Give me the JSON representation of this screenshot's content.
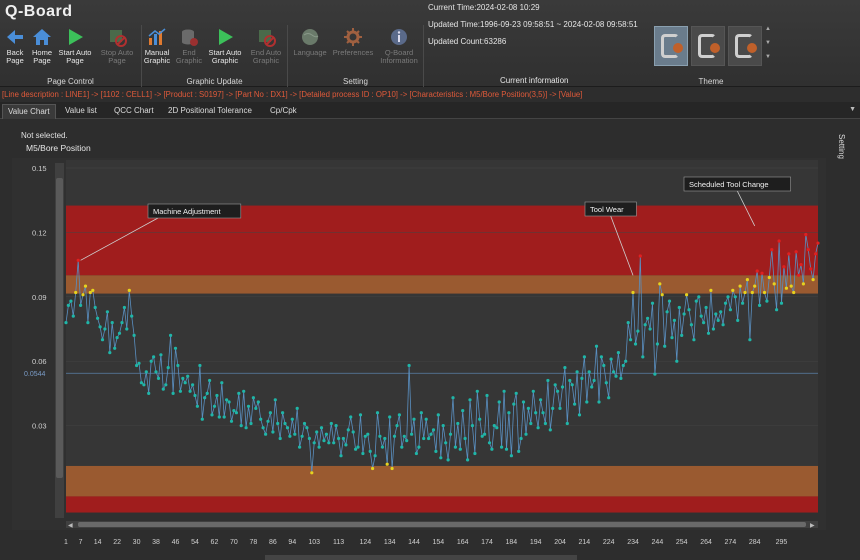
{
  "app": {
    "logo": "Q-Board"
  },
  "ribbon": {
    "page_control": {
      "label": "Page Control",
      "buttons": [
        {
          "name": "back-page-button",
          "label": "Back Page",
          "icon": "arrow-left-icon",
          "enabled": true
        },
        {
          "name": "home-page-button",
          "label": "Home Page",
          "icon": "home-icon",
          "enabled": true
        },
        {
          "name": "start-auto-page-button",
          "label": "Start Auto Page",
          "icon": "play-icon",
          "enabled": true
        },
        {
          "name": "stop-auto-page-button",
          "label": "Stop Auto Page",
          "icon": "stop-icon",
          "enabled": false
        }
      ]
    },
    "graphic_update": {
      "label": "Graphic Update",
      "buttons": [
        {
          "name": "manual-graphic-button",
          "label": "Manual Graphic",
          "icon": "bar-chart-icon",
          "enabled": true
        },
        {
          "name": "end-graphic-button",
          "label": "End Graphic",
          "icon": "database-icon",
          "enabled": false
        },
        {
          "name": "start-auto-graphic-button",
          "label": "Start Auto Graphic",
          "icon": "play-icon",
          "enabled": true
        },
        {
          "name": "end-auto-graphic-button",
          "label": "End Auto Graphic",
          "icon": "stop-icon",
          "enabled": false
        }
      ]
    },
    "setting": {
      "label": "Setting",
      "buttons": [
        {
          "name": "language-button",
          "label": "Language",
          "icon": "globe-icon",
          "enabled": false
        },
        {
          "name": "preferences-button",
          "label": "Preferences",
          "icon": "gear-icon",
          "enabled": false
        },
        {
          "name": "qboard-information-button",
          "label": "Q-Board Information",
          "icon": "info-icon",
          "enabled": false
        }
      ]
    },
    "current_information": {
      "label": "Current information",
      "current_time": "Current Time:2024-02-08 10:29",
      "updated_time": "Updated Time:1996-09-23 09:58:51 ~ 2024-02-08 09:58:51",
      "updated_count": "Updated Count:63286"
    },
    "theme": {
      "label": "Theme"
    }
  },
  "breadcrumb": "[Line description : LINE1] -> [1102 : CELL1] -> [Product : S0197] -> [Part No : DX1] -> [Detailed process ID : OP10] -> [Characteristics : M5/Bore Position(3,5)] -> [Value]",
  "tabs": [
    "Value Chart",
    "Value list",
    "QCC Chart",
    "2D Positional Tolerance",
    "Cp/Cpk"
  ],
  "active_tab": "Value Chart",
  "selection_status": "Not selected.",
  "side_panel_label": "Setting",
  "colors": {
    "limit_band": "#a01d1d",
    "warning_band": "#9a5a30",
    "point_normal": "#1fb6a8",
    "point_warning": "#e6d21e",
    "point_out": "#e02020",
    "line": "#5a8fc0",
    "center_line": "#5a7fa8"
  },
  "chart_data": {
    "type": "line",
    "title": "M5/Bore Position",
    "ylim": [
      0,
      0.15
    ],
    "yticks": [
      "0.15",
      "0.12",
      "0.09",
      "0.06",
      "0.03"
    ],
    "center_line": 0.0544,
    "center_label": "0.0544",
    "usl": 0.1,
    "lsl": 0.0,
    "xticks": [
      1,
      7,
      14,
      22,
      30,
      38,
      46,
      54,
      62,
      70,
      78,
      86,
      94,
      103,
      113,
      124,
      134,
      144,
      154,
      164,
      174,
      184,
      194,
      204,
      214,
      224,
      234,
      244,
      254,
      264,
      274,
      284,
      295
    ],
    "annotations": [
      {
        "text": "Machine Adjustment",
        "x": 7,
        "y": 0.107
      },
      {
        "text": "Tool Wear",
        "x": 234,
        "y": 0.1
      },
      {
        "text": "Scheduled Tool Change",
        "x": 284,
        "y": 0.123
      }
    ],
    "series": [
      {
        "values": [
          0.078,
          0.086,
          0.088,
          0.081,
          0.092,
          0.107,
          0.086,
          0.091,
          0.095,
          0.078,
          0.092,
          0.093,
          0.085,
          0.08,
          0.076,
          0.07,
          0.075,
          0.083,
          0.064,
          0.078,
          0.066,
          0.071,
          0.073,
          0.078,
          0.085,
          0.075,
          0.093,
          0.081,
          0.072,
          0.058,
          0.059,
          0.05,
          0.049,
          0.055,
          0.045,
          0.06,
          0.062,
          0.055,
          0.052,
          0.063,
          0.047,
          0.049,
          0.057,
          0.072,
          0.045,
          0.066,
          0.058,
          0.046,
          0.052,
          0.05,
          0.053,
          0.046,
          0.049,
          0.044,
          0.039,
          0.058,
          0.033,
          0.043,
          0.045,
          0.051,
          0.035,
          0.039,
          0.044,
          0.034,
          0.05,
          0.034,
          0.042,
          0.041,
          0.032,
          0.037,
          0.036,
          0.045,
          0.03,
          0.046,
          0.029,
          0.039,
          0.031,
          0.043,
          0.038,
          0.041,
          0.033,
          0.029,
          0.026,
          0.032,
          0.036,
          0.027,
          0.042,
          0.031,
          0.024,
          0.036,
          0.031,
          0.029,
          0.025,
          0.033,
          0.026,
          0.038,
          0.02,
          0.025,
          0.031,
          0.029,
          0.024,
          0.008,
          0.022,
          0.027,
          0.02,
          0.029,
          0.023,
          0.026,
          0.022,
          0.031,
          0.022,
          0.03,
          0.024,
          0.016,
          0.024,
          0.021,
          0.028,
          0.034,
          0.027,
          0.019,
          0.02,
          0.035,
          0.017,
          0.025,
          0.026,
          0.018,
          0.01,
          0.016,
          0.036,
          0.025,
          0.02,
          0.024,
          0.012,
          0.034,
          0.01,
          0.025,
          0.03,
          0.035,
          0.02,
          0.025,
          0.023,
          0.058,
          0.026,
          0.033,
          0.017,
          0.02,
          0.036,
          0.024,
          0.033,
          0.024,
          0.026,
          0.028,
          0.018,
          0.035,
          0.015,
          0.03,
          0.022,
          0.014,
          0.026,
          0.043,
          0.02,
          0.031,
          0.019,
          0.037,
          0.024,
          0.014,
          0.042,
          0.03,
          0.017,
          0.046,
          0.033,
          0.025,
          0.026,
          0.044,
          0.022,
          0.019,
          0.03,
          0.029,
          0.041,
          0.02,
          0.046,
          0.019,
          0.036,
          0.016,
          0.04,
          0.045,
          0.018,
          0.024,
          0.041,
          0.026,
          0.038,
          0.031,
          0.046,
          0.036,
          0.029,
          0.042,
          0.036,
          0.031,
          0.051,
          0.028,
          0.038,
          0.049,
          0.046,
          0.038,
          0.048,
          0.057,
          0.031,
          0.051,
          0.049,
          0.04,
          0.055,
          0.035,
          0.052,
          0.062,
          0.041,
          0.055,
          0.048,
          0.051,
          0.067,
          0.041,
          0.062,
          0.058,
          0.05,
          0.043,
          0.061,
          0.055,
          0.053,
          0.064,
          0.052,
          0.058,
          0.06,
          0.078,
          0.07,
          0.092,
          0.068,
          0.074,
          0.109,
          0.062,
          0.077,
          0.08,
          0.075,
          0.087,
          0.054,
          0.068,
          0.096,
          0.091,
          0.067,
          0.083,
          0.088,
          0.071,
          0.079,
          0.06,
          0.085,
          0.072,
          0.082,
          0.091,
          0.084,
          0.077,
          0.07,
          0.088,
          0.09,
          0.081,
          0.078,
          0.085,
          0.073,
          0.093,
          0.075,
          0.082,
          0.079,
          0.083,
          0.077,
          0.087,
          0.09,
          0.084,
          0.093,
          0.09,
          0.079,
          0.095,
          0.087,
          0.092,
          0.098,
          0.07,
          0.092,
          0.095,
          0.102,
          0.086,
          0.101,
          0.092,
          0.088,
          0.099,
          0.112,
          0.096,
          0.084,
          0.116,
          0.087,
          0.104,
          0.094,
          0.11,
          0.095,
          0.092,
          0.111,
          0.1,
          0.105,
          0.096,
          0.119,
          0.112,
          0.103,
          0.098,
          0.11,
          0.115
        ]
      }
    ]
  }
}
